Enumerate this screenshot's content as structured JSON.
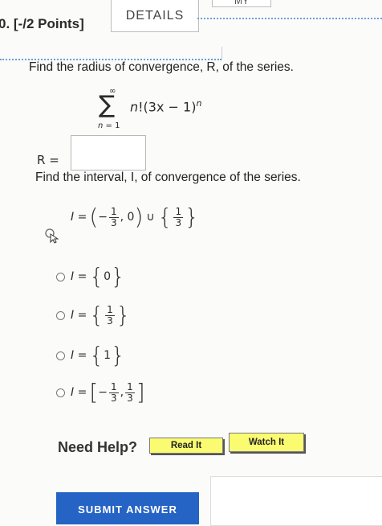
{
  "question": {
    "number": "0. [-/2 Points]",
    "details_tab": "DETAILS",
    "my_tab": "MY"
  },
  "part1": {
    "prompt": "Find the radius of convergence, R, of the series.",
    "sum_upper": "∞",
    "sum_lower_var": "n",
    "sum_lower_rest": " = 1",
    "term_factor": "n",
    "term_rest": "!(3x − 1)",
    "term_exp": "n",
    "r_label": "R =",
    "r_value": ""
  },
  "part2": {
    "prompt": "Find the interval, I, of convergence of the series.",
    "options": [
      {
        "label": "I =",
        "selected": true
      },
      {
        "label": "I =",
        "value": "0",
        "selected": false
      },
      {
        "label": "I =",
        "selected": false
      },
      {
        "label": "I =",
        "value": "1",
        "selected": false
      },
      {
        "label": "I =",
        "selected": false
      }
    ],
    "opt1": {
      "minus": "−",
      "num": "1",
      "den": "3",
      "zero": ", 0",
      "union": "∪",
      "num2": "1",
      "den2": "3"
    },
    "opt3": {
      "num": "1",
      "den": "3"
    },
    "opt5": {
      "minus": "−",
      "num": "1",
      "den": "3",
      "comma": ",",
      "num2": "1",
      "den2": "3"
    }
  },
  "help": {
    "label": "Need Help?",
    "read_it": "Read It",
    "watch_it": "Watch It"
  },
  "submit_label": "SUBMIT ANSWER",
  "colors": {
    "accent_dots": "#6f9ed8",
    "help_button": "#fbfb72",
    "submit": "#2563c5"
  }
}
